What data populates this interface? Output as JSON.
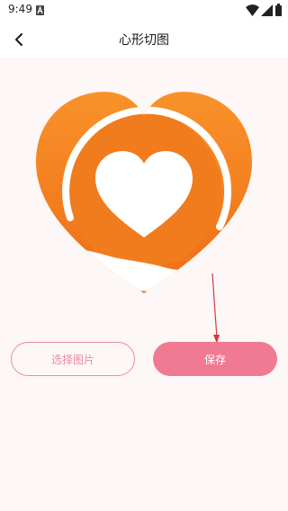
{
  "status_bar": {
    "time": "9:49",
    "icons": [
      "a-notification-icon",
      "wifi-icon",
      "signal-icon",
      "battery-icon"
    ]
  },
  "header": {
    "title": "心形切图",
    "back_icon": "chevron-left-icon"
  },
  "actions": {
    "choose_image_label": "选择图片",
    "save_label": "保存"
  },
  "colors": {
    "content_background": "#fef7f7",
    "heart_orange": "#f5821f",
    "heart_orange_dark": "#e8651a",
    "outline_button_border": "#ea8ca0",
    "save_button": "#f07a92",
    "annotation_arrow": "#d63a3a"
  }
}
